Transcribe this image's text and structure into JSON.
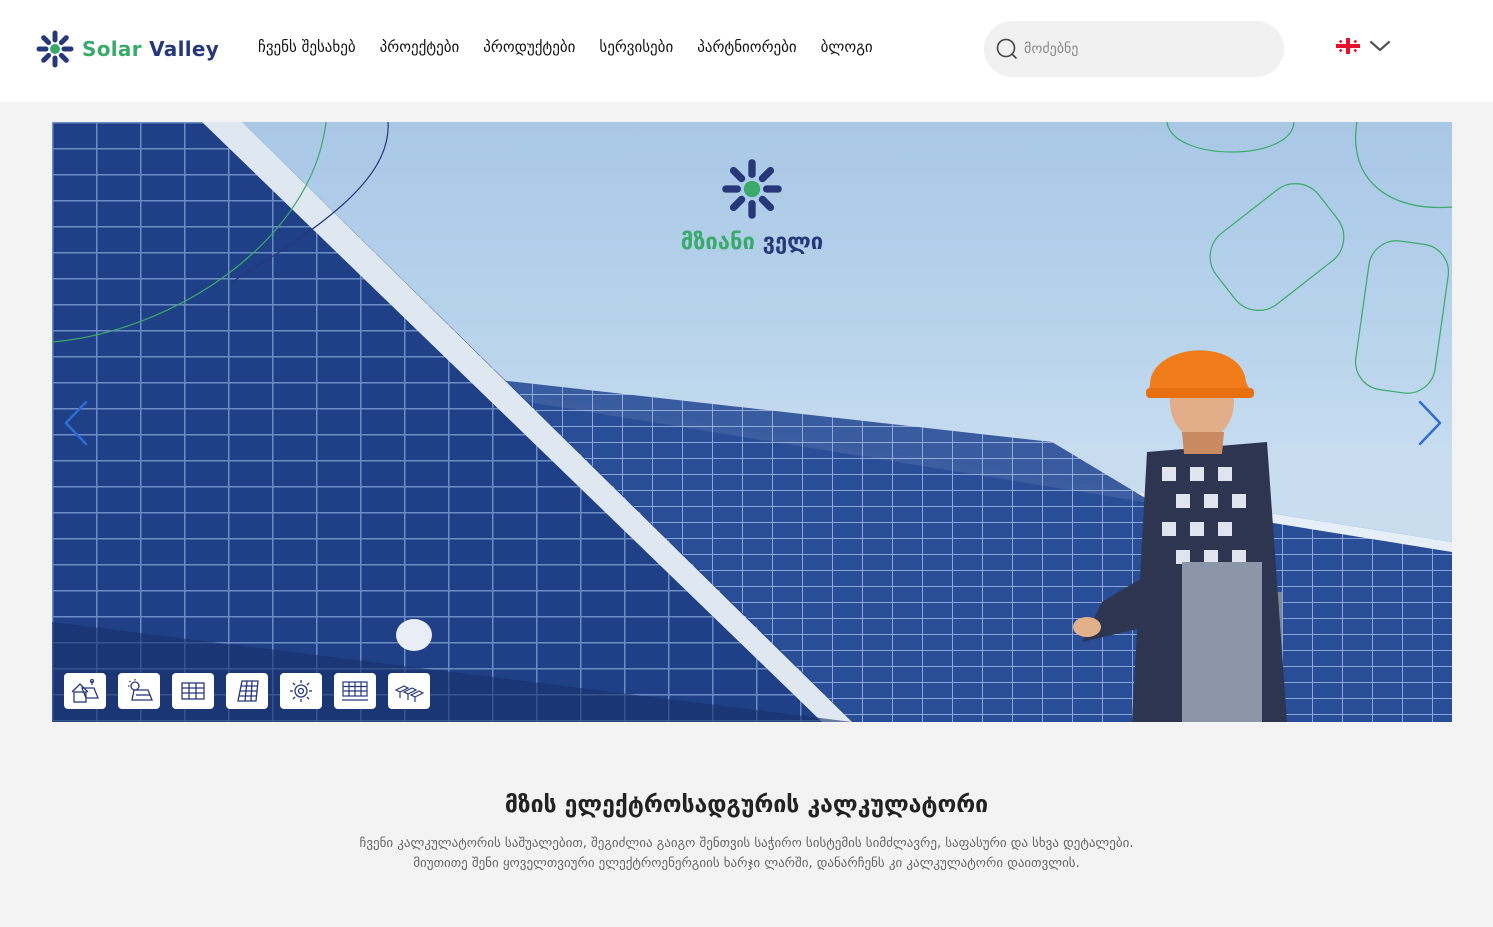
{
  "brand": {
    "name_part1": "Solar",
    "name_part2": "Valley",
    "accent_green": "#3aaa6a",
    "accent_navy": "#27387a"
  },
  "nav": {
    "items": [
      "ჩვენს შესახებ",
      "პროექტები",
      "პროდუქტები",
      "სერვისები",
      "პარტნიორები",
      "ბლოგი"
    ]
  },
  "search": {
    "placeholder": "მოძებნე",
    "icon": "search-icon"
  },
  "language": {
    "flag": "georgia-flag-icon",
    "dropdown_icon": "chevron-down-icon"
  },
  "hero": {
    "brand_text_part1": "მზიანი",
    "brand_text_part2": "ველი",
    "prev_icon": "chevron-left-icon",
    "next_icon": "chevron-right-icon",
    "thumbnails": [
      "house-solar-icon",
      "solar-sun-panel-icon",
      "roof-panel-icon",
      "solar-panel-icon",
      "gear-sun-icon",
      "panel-grid-icon",
      "panel-array-icon"
    ]
  },
  "calculator": {
    "title": "მზის ელექტროსადგურის კალკულატორი",
    "desc_line1": "ჩვენი კალკულატორის საშუალებით, შეგიძლია გაიგო შენთვის საჭირო სისტემის სიმძლავრე, საფასური და სხვა დეტალები.",
    "desc_line2": "მიუთითე შენი ყოველთვიური ელექტროენერგიის ხარჯი ლარში, დანარჩენს კი კალკულატორი დაითვლის."
  }
}
